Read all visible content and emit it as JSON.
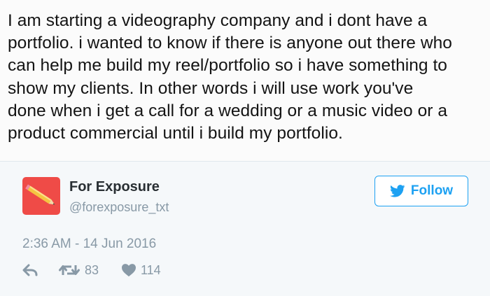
{
  "quote": {
    "lines": [
      "I am starting a videography company and i dont have a",
      "portfolio. i wanted to know if there is anyone out there who",
      "can help me build my reel/portfolio so i have something to",
      "show my clients. In other words i will use work you've",
      "done when i get a call for a wedding or a music video or a",
      "product commercial until i build my portfolio."
    ]
  },
  "tweet": {
    "name": "For Exposure",
    "handle": "@forexposure_txt",
    "follow_label": "Follow",
    "timestamp": "2:36 AM - 14 Jun 2016",
    "retweets": "83",
    "likes": "114",
    "avatar_icon": "pencil-icon",
    "colors": {
      "accent": "#1da1f2",
      "avatar_bg": "#ef4b47",
      "muted": "#8899a6",
      "spellcheck": "#e0433a"
    }
  }
}
